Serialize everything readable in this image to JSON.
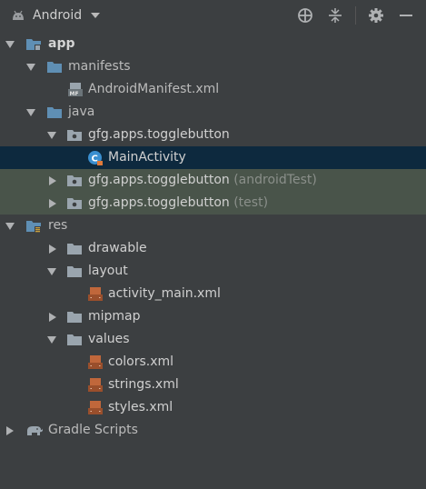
{
  "toolbar": {
    "view_label": "Android",
    "icons": [
      "crosshair-icon",
      "collapse-all-icon",
      "gear-icon",
      "minimize-icon"
    ]
  },
  "tree": {
    "app": "app",
    "manifests": "manifests",
    "android_manifest": "AndroidManifest.xml",
    "java": "java",
    "pkg_main": "gfg.apps.togglebutton",
    "main_activity": "MainActivity",
    "pkg_android_test": "gfg.apps.togglebutton",
    "android_test_suffix": "(androidTest)",
    "pkg_test": "gfg.apps.togglebutton",
    "test_suffix": "(test)",
    "res": "res",
    "drawable": "drawable",
    "layout": "layout",
    "activity_main": "activity_main.xml",
    "mipmap": "mipmap",
    "values": "values",
    "colors": "colors.xml",
    "strings": "strings.xml",
    "styles": "styles.xml",
    "gradle_scripts": "Gradle Scripts"
  },
  "colors": {
    "background": "#3c3f41",
    "selected_row": "#0d293e",
    "test_row": "#49544a",
    "folder_blue": "#5f8fb4",
    "xml_orange": "#c0673b"
  }
}
